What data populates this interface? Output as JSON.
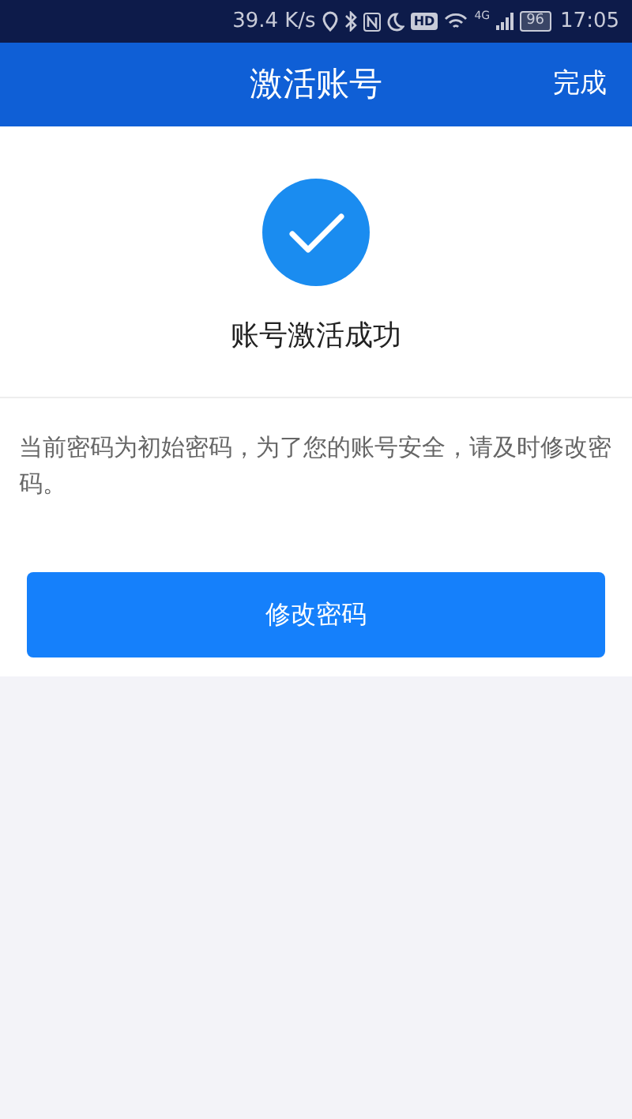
{
  "status_bar": {
    "speed": "39.4 K/s",
    "hd": "HD",
    "network": "4G",
    "battery": "96",
    "time": "17:05"
  },
  "header": {
    "title": "激活账号",
    "action": "完成"
  },
  "result": {
    "message": "账号激活成功"
  },
  "notice": "当前密码为初始密码，为了您的账号安全，请及时修改密码。",
  "button": "修改密码"
}
